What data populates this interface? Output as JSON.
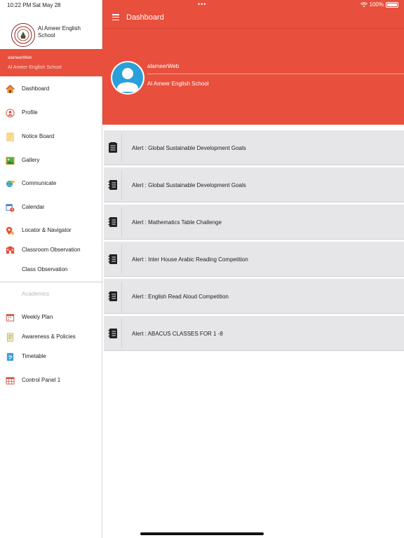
{
  "status": {
    "time": "10:22 PM",
    "date": "Sat May 28",
    "dots": "•••",
    "battery": "100%"
  },
  "header": {
    "title": "Dashboard"
  },
  "profile": {
    "username": "alameerWeb",
    "school": "Al Ameer English School"
  },
  "sidebar": {
    "school_name": "Al Ameer English School",
    "user": {
      "username": "alameerWeb",
      "school": "Al Ameer English School"
    },
    "items": [
      {
        "label": "Dashboard",
        "icon": "home-icon"
      },
      {
        "label": "Profile",
        "icon": "profile-icon"
      },
      {
        "label": "Notice Board",
        "icon": "notice-board-icon"
      },
      {
        "label": "Gallery",
        "icon": "gallery-icon"
      },
      {
        "label": "Communicate",
        "icon": "communicate-icon"
      },
      {
        "label": "Calendar",
        "icon": "calendar-icon"
      },
      {
        "label": "Locator & Navigator",
        "icon": "locator-icon"
      },
      {
        "label": "Classroom Observation",
        "icon": "classroom-icon"
      },
      {
        "label": "Class Observation",
        "icon": ""
      }
    ],
    "section_label": "Academics",
    "academic_items": [
      {
        "label": "Weekly Plan",
        "icon": "weekly-plan-icon"
      },
      {
        "label": "Awareness & Policies",
        "icon": "policies-icon"
      },
      {
        "label": "Timetable",
        "icon": "timetable-icon"
      },
      {
        "label": "Control Panel 1",
        "icon": "control-panel-icon"
      }
    ]
  },
  "alerts": [
    {
      "label": "Alert : Global Sustainable Development Goals",
      "icon": "notepad-icon"
    },
    {
      "label": "Alert : Global Sustainable Development Goals",
      "icon": "notebook-icon"
    },
    {
      "label": "Alert : Mathematics Table Challenge",
      "icon": "notebook-icon"
    },
    {
      "label": "Alert : Inter House Arabic Reading Competition",
      "icon": "notebook-icon"
    },
    {
      "label": "Alert : English Read Aloud Competition",
      "icon": "notebook-icon"
    },
    {
      "label": "Alert : ABACUS CLASSES FOR 1 -8",
      "icon": "notebook-icon"
    }
  ],
  "colors": {
    "accent": "#e84f3c",
    "card": "#e6e5e8"
  }
}
